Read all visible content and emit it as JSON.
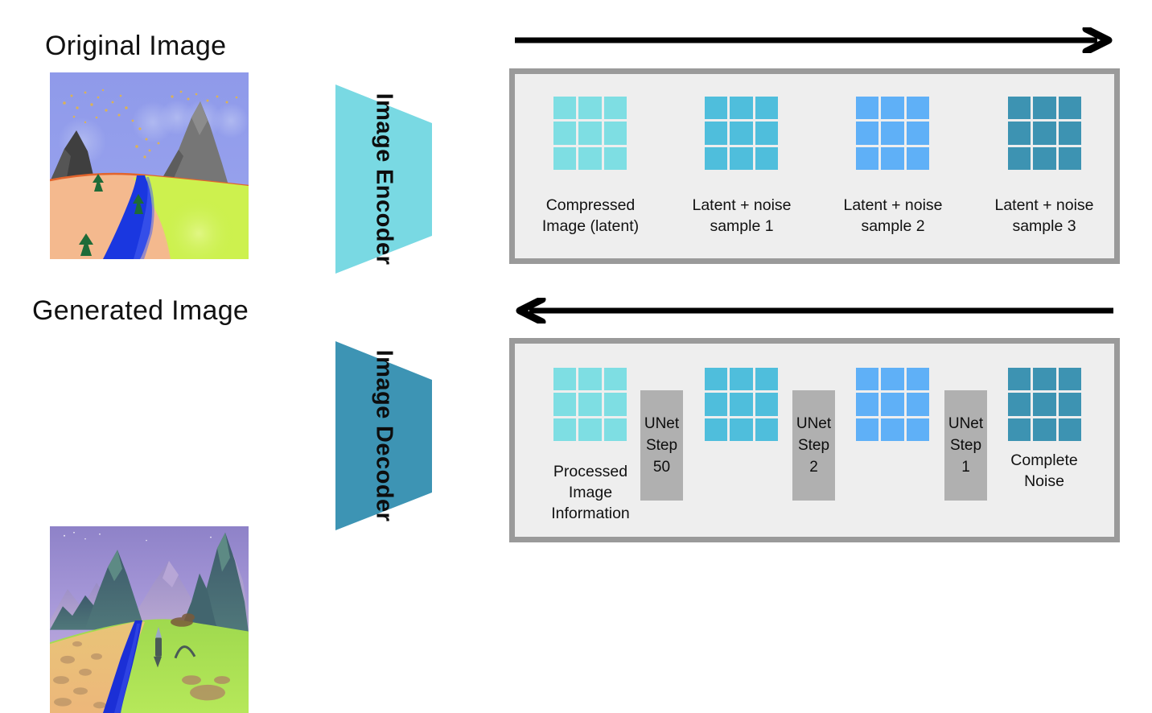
{
  "colors": {
    "latent_light": "#7edee3",
    "noise1": "#4fbedc",
    "noise2": "#5fb0f7",
    "noise3": "#3d93b2",
    "encoder": "#79d9e3",
    "decoder": "#3d94b4",
    "panel_bg": "#eeeeee",
    "panel_border": "#9a9a9a",
    "unet_block": "#b0b0b0",
    "arrow": "#000000"
  },
  "left": {
    "original": {
      "title": "Original Image",
      "image_name": "original-landscape-illustration"
    },
    "generated": {
      "title": "Generated Image",
      "image_name": "generated-landscape-render"
    }
  },
  "encoder": {
    "line1": "Image",
    "line2": "Encoder"
  },
  "decoder": {
    "line1": "Image",
    "line2": "Decoder"
  },
  "arrows": {
    "top": "arrow-right",
    "bottom": "arrow-left"
  },
  "forward_panel": {
    "items": [
      {
        "caption": "Compressed\nImage (latent)",
        "color_key": "latent_light"
      },
      {
        "caption": "Latent + noise\nsample 1",
        "color_key": "noise1"
      },
      {
        "caption": "Latent + noise\nsample 2",
        "color_key": "noise2"
      },
      {
        "caption": "Latent + noise\nsample 3",
        "color_key": "noise3"
      }
    ]
  },
  "reverse_panel": {
    "grids": [
      {
        "caption": "Processed\nImage\nInformation",
        "color_key": "latent_light"
      },
      {
        "caption": "",
        "color_key": "noise1"
      },
      {
        "caption": "",
        "color_key": "noise2"
      },
      {
        "caption": "Complete\nNoise",
        "color_key": "noise3"
      }
    ],
    "steps": [
      {
        "label": "UNet",
        "sub": "Step",
        "num": "50"
      },
      {
        "label": "UNet",
        "sub": "Step",
        "num": "2"
      },
      {
        "label": "UNet",
        "sub": "Step",
        "num": "1"
      }
    ]
  }
}
